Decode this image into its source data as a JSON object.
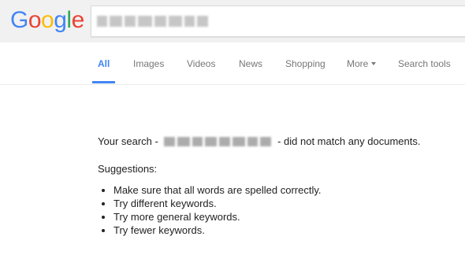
{
  "logo": {
    "letters": [
      "G",
      "o",
      "o",
      "g",
      "l",
      "e"
    ],
    "colors": [
      "#4285f4",
      "#ea4335",
      "#fbbc05",
      "#4285f4",
      "#34a853",
      "#ea4335"
    ]
  },
  "search": {
    "query_blurred": true
  },
  "tabs": [
    {
      "label": "All",
      "active": true
    },
    {
      "label": "Images",
      "active": false
    },
    {
      "label": "Videos",
      "active": false
    },
    {
      "label": "News",
      "active": false
    },
    {
      "label": "Shopping",
      "active": false
    },
    {
      "label": "More",
      "active": false
    },
    {
      "label": "Search tools",
      "active": false
    }
  ],
  "results": {
    "message_prefix": "Your search -",
    "message_suffix": "- did not match any documents.",
    "suggestions_title": "Suggestions:",
    "suggestions": [
      "Make sure that all words are spelled correctly.",
      "Try different keywords.",
      "Try more general keywords.",
      "Try fewer keywords."
    ]
  },
  "colors": {
    "accent": "#4285f4",
    "header_bg": "#f1f1f1",
    "tab_text": "#777777"
  }
}
